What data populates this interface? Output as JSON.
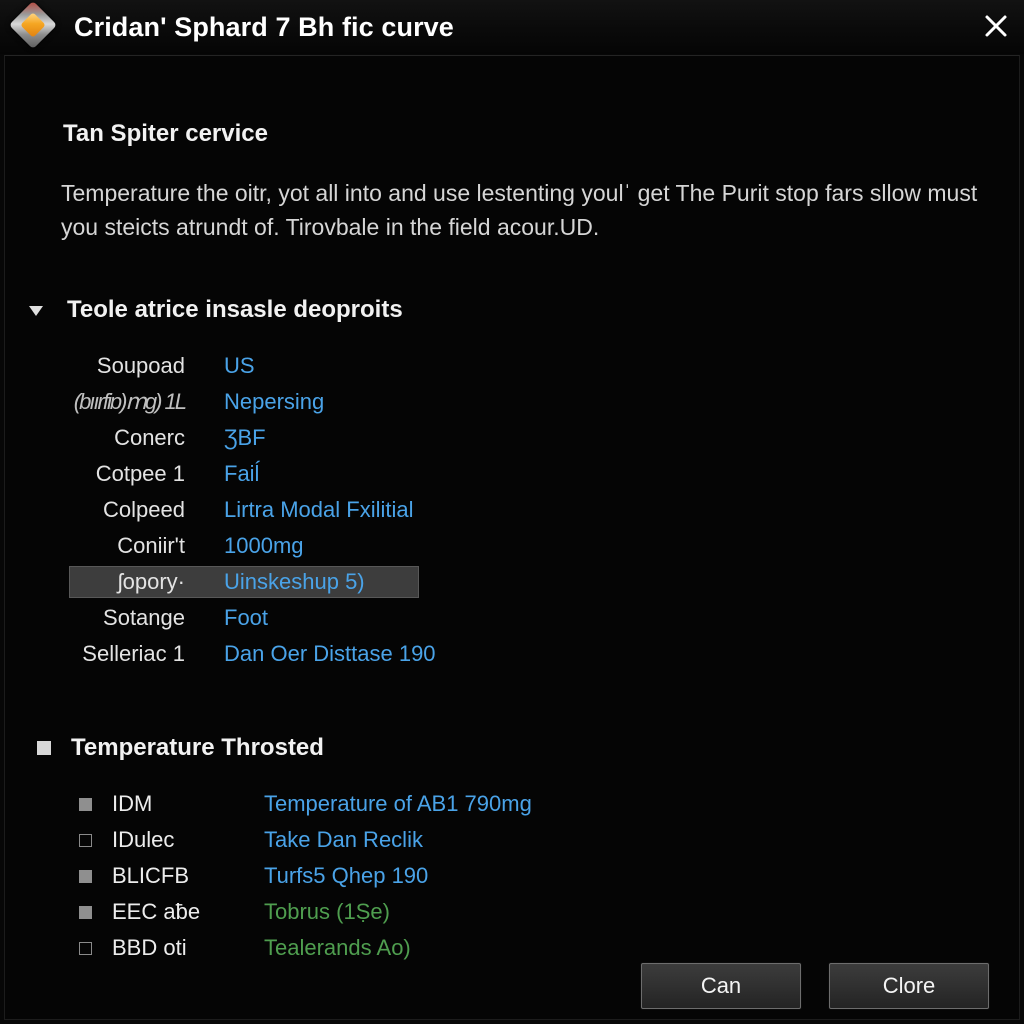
{
  "window": {
    "title": "Cridan' Sphard 7 Bh fic curve",
    "app_icon": "diamond-gem-icon",
    "close_icon": "close-icon"
  },
  "body": {
    "section_title": "Tan Spiter cervice",
    "paragraph": "Temperature the oitr, yot all into and use lestenting youlˈ get The Purit stop fars sllow must you steicts atrundt of. Tirovbale in the field acour.UD."
  },
  "group1": {
    "toggle_icon": "triangle-down-icon",
    "label": "Teole atrice insasle deoproits",
    "rows": [
      {
        "key": "Soupoad",
        "value": "US"
      },
      {
        "key": "(bıırfiɒ)ⅿg) 1L",
        "value": "Nepersing"
      },
      {
        "key": "Conerc",
        "value": "ƷBF"
      },
      {
        "key": "Cotpee 1",
        "value": "Faiĺ"
      },
      {
        "key": "Colpeed",
        "value": "Lirtra Modal Fxilitial"
      },
      {
        "key": "Coniir't",
        "value": "1000mg"
      },
      {
        "key": "ʃopory·",
        "value": "Uinskeshup 5)"
      },
      {
        "key": "Sotange",
        "value": "Foot"
      },
      {
        "key": "Selleriac 1",
        "value": "Dan Oer Disttase 190"
      }
    ],
    "selected_row_index": 6
  },
  "group2": {
    "bullet_icon": "square-filled-icon",
    "label": "Temperature Throsted",
    "rows": [
      {
        "bullet": "square-filled-icon",
        "key": "IDM",
        "value": "Temperature of AB1 790mg",
        "value_color": "blue"
      },
      {
        "bullet": "square-hollow-icon",
        "key": "IDulec",
        "value": "Take Dan Reclik",
        "value_color": "blue"
      },
      {
        "bullet": "square-filled-icon",
        "key": "BLICFB",
        "value": "Turfs5 Qhep 190",
        "value_color": "blue"
      },
      {
        "bullet": "square-filled-icon",
        "key": "EEC aƀe",
        "value": "Tobrus (1Ṣe)",
        "value_color": "green"
      },
      {
        "bullet": "square-hollow-icon",
        "key": "BBD oti",
        "value": "Tealerands Ao)",
        "value_color": "green"
      }
    ]
  },
  "footer": {
    "cancel_label": "Can",
    "close_label": "Clore"
  },
  "colors": {
    "accent_blue": "#4aa3e8",
    "accent_green": "#4f9e4f",
    "selection": "#3d3d3d",
    "background": "#050505"
  }
}
